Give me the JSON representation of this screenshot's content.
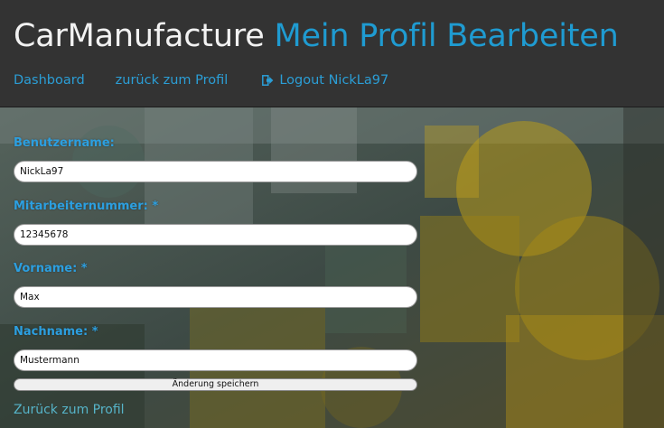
{
  "header": {
    "brand": "CarManufacture",
    "page_title": "Mein Profil Bearbeiten"
  },
  "nav": {
    "dashboard": "Dashboard",
    "back_to_profile": "zurück zum Profil",
    "logout": "Logout NickLa97",
    "logout_icon": "logout-icon"
  },
  "form": {
    "username_label": "Benutzername:",
    "username_value": "NickLa97",
    "employee_number_label": "Mitarbeiternummer: *",
    "employee_number_value": "12345678",
    "first_name_label": "Vorname: *",
    "first_name_value": "Max",
    "last_name_label": "Nachname: *",
    "last_name_value": "Mustermann",
    "save_label": "Änderung speichern",
    "back_link": "Zurück zum Profil"
  },
  "colors": {
    "accent": "#1f9bd1",
    "header_bg": "#333333",
    "label": "#2c9fe0"
  }
}
